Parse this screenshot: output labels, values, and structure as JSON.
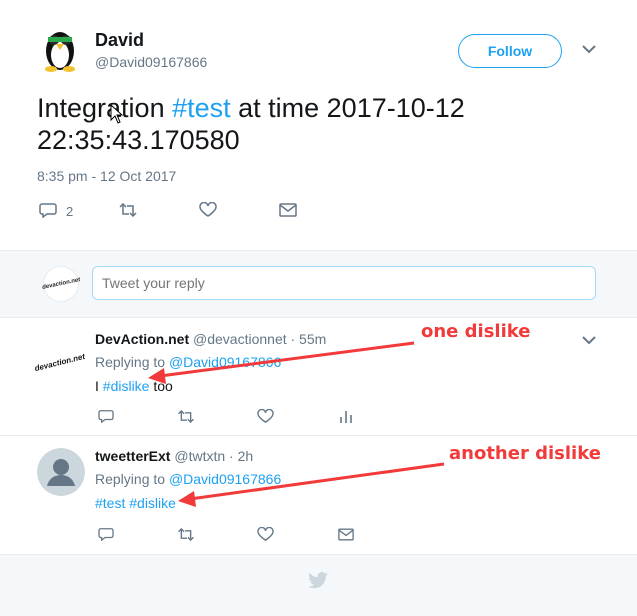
{
  "tweet": {
    "name": "David",
    "handle": "@David09167866",
    "follow_label": "Follow",
    "text_before": "Integration ",
    "hashtag": "#test",
    "text_after": " at time 2017-10-12 22:35:43.170580",
    "timestamp": "8:35 pm - 12 Oct 2017",
    "reply_count": "2"
  },
  "reply_box": {
    "placeholder": "Tweet your reply",
    "avatar_text": "devaction.net"
  },
  "replies": [
    {
      "name": "DevAction.net",
      "handle": "@devactionnet · 55m",
      "replying_prefix": "Replying to ",
      "replying_to": "@David09167866",
      "text_before": "I ",
      "hashtag": "#dislike",
      "text_after": " too",
      "avatar_text": "devaction.net"
    },
    {
      "name": "tweetterExt",
      "handle": "@twtxtn · 2h",
      "replying_prefix": "Replying to ",
      "replying_to": "@David09167866",
      "hashtag1": "#test",
      "hashtag2": "#dislike"
    }
  ],
  "annotations": {
    "first": "one dislike",
    "second": "another dislike"
  },
  "colors": {
    "accent": "#1da1f2",
    "annotation": "#f23a3a",
    "muted": "#657786"
  }
}
